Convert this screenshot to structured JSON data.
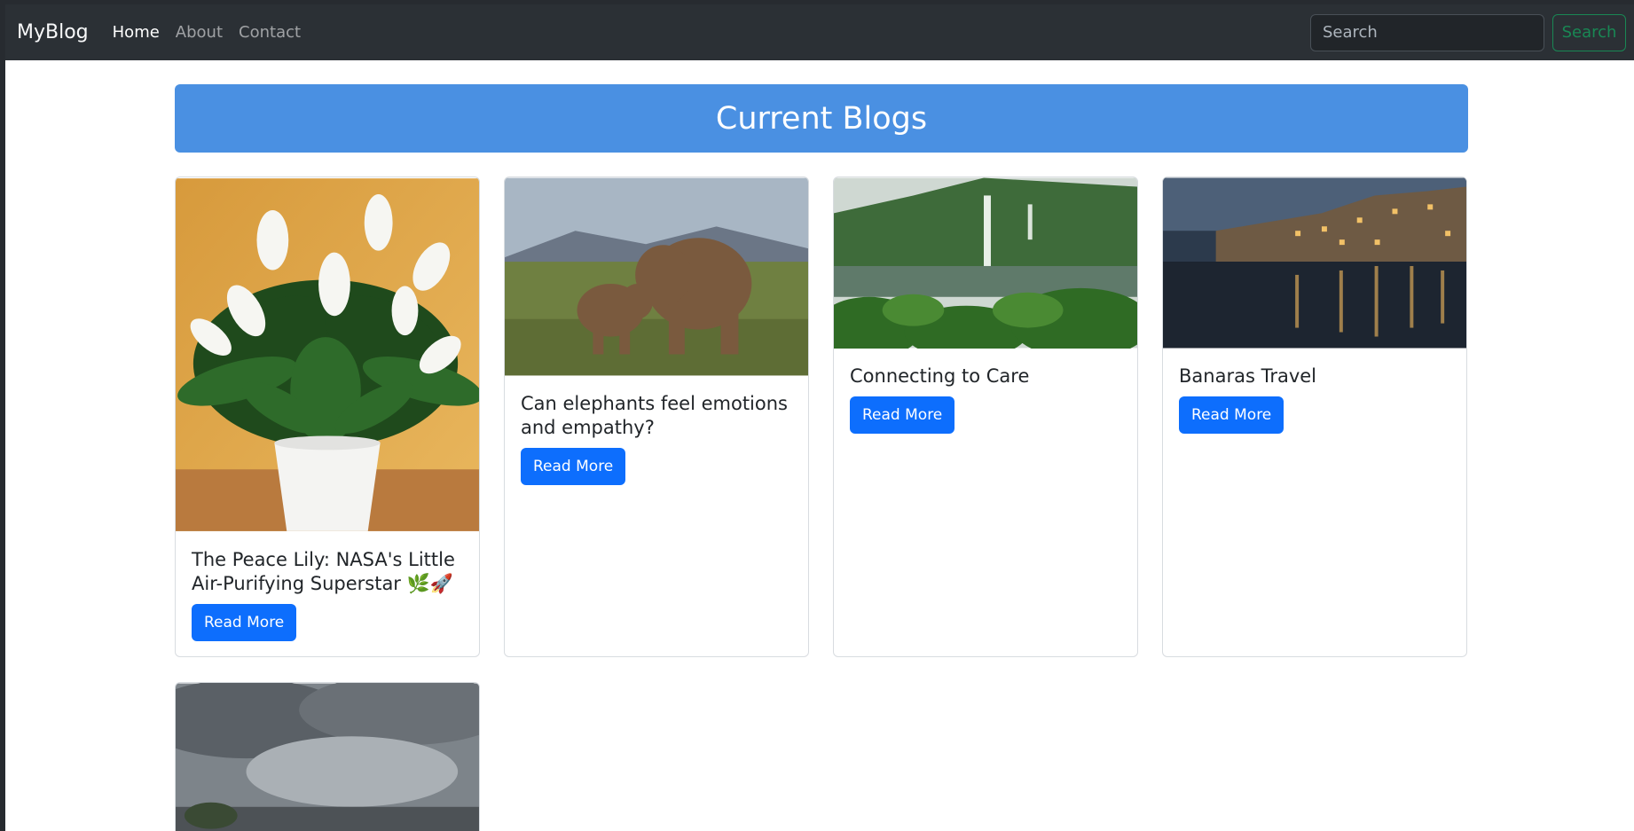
{
  "navbar": {
    "brand": "MyBlog",
    "links": [
      "Home",
      "About",
      "Contact"
    ],
    "search_placeholder": "Search",
    "search_button": "Search"
  },
  "banner": {
    "title": "Current Blogs"
  },
  "cards": [
    {
      "title": "The Peace Lily: NASA's Little Air-Purifying Superstar 🌿🚀",
      "button": "Read More",
      "image": "peace-lily-plant"
    },
    {
      "title": "Can elephants feel emotions and empathy?",
      "button": "Read More",
      "image": "elephants-savanna"
    },
    {
      "title": "Connecting to Care",
      "button": "Read More",
      "image": "waterfall-forest"
    },
    {
      "title": "Banaras Travel",
      "button": "Read More",
      "image": "banaras-ghats-night"
    },
    {
      "title": "",
      "button": "",
      "image": "stormy-clouds"
    }
  ],
  "colors": {
    "navbar_bg": "#2b3035",
    "banner_bg": "#4a90e2",
    "primary": "#0d6efd",
    "success_outline": "#198754"
  }
}
